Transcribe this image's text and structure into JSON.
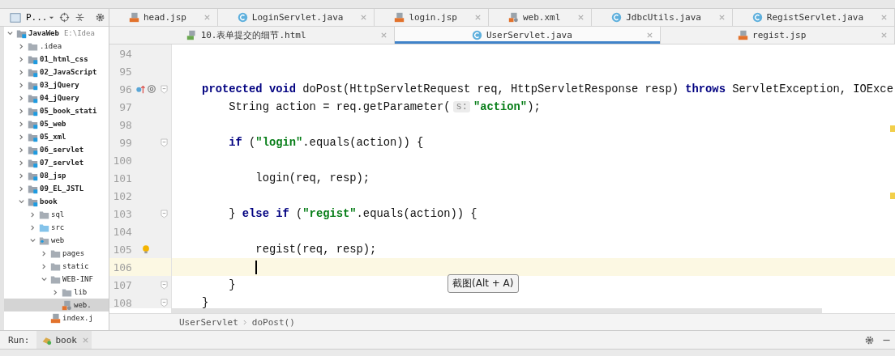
{
  "project_panel": {
    "title": "P...",
    "tree": [
      {
        "label": "JavaWeb",
        "path": "E:\\Idea",
        "kind": "module",
        "expanded": true,
        "selected": false,
        "children": [
          {
            "label": ".idea",
            "kind": "folder",
            "expanded": false,
            "selected": false
          },
          {
            "label": "01_html_css",
            "kind": "module",
            "expanded": false,
            "selected": false
          },
          {
            "label": "02_JavaScript",
            "kind": "module",
            "expanded": false,
            "selected": false
          },
          {
            "label": "03_jQuery",
            "kind": "module",
            "expanded": false,
            "selected": false
          },
          {
            "label": "04_jQuery",
            "kind": "module",
            "expanded": false,
            "selected": false
          },
          {
            "label": "05_book_stati",
            "kind": "module",
            "expanded": false,
            "selected": false
          },
          {
            "label": "05_web",
            "kind": "module",
            "expanded": false,
            "selected": false
          },
          {
            "label": "05_xml",
            "kind": "module",
            "expanded": false,
            "selected": false
          },
          {
            "label": "06_servlet",
            "kind": "module",
            "expanded": false,
            "selected": false
          },
          {
            "label": "07_servlet",
            "kind": "module",
            "expanded": false,
            "selected": false
          },
          {
            "label": "08_jsp",
            "kind": "module",
            "expanded": false,
            "selected": false
          },
          {
            "label": "09_EL_JSTL",
            "kind": "module",
            "expanded": false,
            "selected": false
          },
          {
            "label": "book",
            "kind": "module",
            "expanded": true,
            "selected": false,
            "children": [
              {
                "label": "sql",
                "kind": "folder",
                "expanded": false,
                "selected": false
              },
              {
                "label": "src",
                "kind": "source",
                "expanded": false,
                "selected": false
              },
              {
                "label": "web",
                "kind": "web",
                "expanded": true,
                "selected": false,
                "children": [
                  {
                    "label": "pages",
                    "kind": "folder",
                    "expanded": false,
                    "selected": false
                  },
                  {
                    "label": "static",
                    "kind": "folder",
                    "expanded": false,
                    "selected": false
                  },
                  {
                    "label": "WEB-INF",
                    "kind": "folder",
                    "expanded": true,
                    "selected": false,
                    "children": [
                      {
                        "label": "lib",
                        "kind": "folder",
                        "expanded": false,
                        "selected": false
                      },
                      {
                        "label": "web.",
                        "kind": "xml",
                        "selected": true
                      }
                    ]
                  },
                  {
                    "label": "index.j",
                    "kind": "jsp",
                    "selected": false
                  }
                ]
              }
            ]
          }
        ]
      }
    ]
  },
  "tabs": [
    [
      {
        "label": "head.jsp",
        "kind": "jsp",
        "selected": false
      },
      {
        "label": "LoginServlet.java",
        "kind": "java",
        "selected": false
      },
      {
        "label": "login.jsp",
        "kind": "jsp",
        "selected": false
      },
      {
        "label": "web.xml",
        "kind": "xml",
        "selected": false
      },
      {
        "label": "JdbcUtils.java",
        "kind": "java",
        "selected": false
      },
      {
        "label": "RegistServlet.java",
        "kind": "java",
        "selected": false
      }
    ],
    [
      {
        "label": "10.表单提交的细节.html",
        "kind": "html",
        "selected": false
      },
      {
        "label": "UserServlet.java",
        "kind": "java",
        "selected": true
      },
      {
        "label": "regist.jsp",
        "kind": "jsp",
        "selected": false
      }
    ]
  ],
  "editor": {
    "lines": [
      {
        "number": "94"
      },
      {
        "number": "95"
      },
      {
        "number": "96",
        "gutter_icons": true,
        "fold": true,
        "tokens": [
          {
            "kind": "keyword",
            "text": "    protected void"
          },
          {
            "kind": "plain",
            "text": " doPost(HttpServletRequest req, HttpServletResponse resp) "
          },
          {
            "kind": "keyword",
            "text": "throws"
          },
          {
            "kind": "plain",
            "text": " ServletException, IOExce"
          }
        ]
      },
      {
        "number": "97",
        "tokens": [
          {
            "kind": "plain",
            "text": "        String action = req.getParameter("
          },
          {
            "kind": "hint",
            "text": "s:"
          },
          {
            "kind": "string",
            "text": "\"action\""
          },
          {
            "kind": "plain",
            "text": ");"
          }
        ]
      },
      {
        "number": "98"
      },
      {
        "number": "99",
        "fold": true,
        "tokens": [
          {
            "kind": "keyword",
            "text": "        if"
          },
          {
            "kind": "plain",
            "text": " ("
          },
          {
            "kind": "string",
            "text": "\"login\""
          },
          {
            "kind": "plain",
            "text": ".equals(action)) {"
          }
        ]
      },
      {
        "number": "100"
      },
      {
        "number": "101",
        "tokens": [
          {
            "kind": "plain",
            "text": "            login(req, resp);"
          }
        ]
      },
      {
        "number": "102"
      },
      {
        "number": "103",
        "fold": true,
        "tokens": [
          {
            "kind": "plain",
            "text": "        } "
          },
          {
            "kind": "keyword",
            "text": "else if"
          },
          {
            "kind": "plain",
            "text": " ("
          },
          {
            "kind": "string",
            "text": "\"regist\""
          },
          {
            "kind": "plain",
            "text": ".equals(action)) {"
          }
        ]
      },
      {
        "number": "104"
      },
      {
        "number": "105",
        "bulb": true,
        "tokens": [
          {
            "kind": "plain",
            "text": "            regist(req, resp);"
          }
        ]
      },
      {
        "number": "106",
        "current": true
      },
      {
        "number": "107",
        "fold": true,
        "tokens": [
          {
            "kind": "plain",
            "text": "        }"
          }
        ]
      },
      {
        "number": "108",
        "fold": true,
        "tokens": [
          {
            "kind": "plain",
            "text": "    }"
          }
        ]
      }
    ],
    "tooltip": "截图(Alt + A)",
    "breadcrumbs": [
      "UserServlet",
      "doPost()"
    ]
  },
  "run_bar": {
    "label": "Run:",
    "tab": "book"
  }
}
